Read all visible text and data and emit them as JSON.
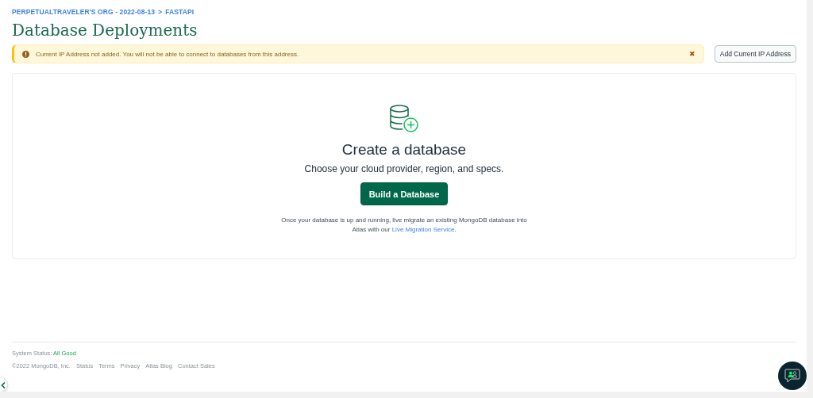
{
  "breadcrumb": {
    "org": "PERPETUALTRAVELER'S ORG - 2022-08-13",
    "separator": ">",
    "project": "FASTAPI"
  },
  "page_title": "Database Deployments",
  "alert": {
    "message": "Current IP Address not added. You will not be able to connect to databases from this address.",
    "close": "✖"
  },
  "alert_action": "Add Current IP Address",
  "empty_state": {
    "title": "Create a database",
    "subtitle": "Choose your cloud provider, region, and specs.",
    "button": "Build a Database",
    "note": "Once your database is up and running, live migrate an existing MongoDB database into Atlas with our",
    "link": "Live Migration Service",
    "note_end": "."
  },
  "footer": {
    "status_label": "System Status:",
    "status_value": "All Good",
    "copyright": "©2022 MongoDB, Inc.",
    "links": [
      "Status",
      "Terms",
      "Privacy",
      "Atlas Blog",
      "Contact Sales"
    ]
  }
}
